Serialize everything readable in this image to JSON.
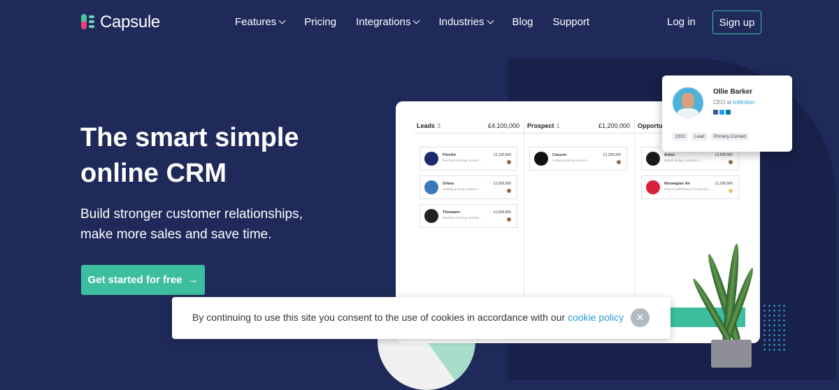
{
  "brand": {
    "name": "Capsule"
  },
  "nav": {
    "items": [
      {
        "label": "Features",
        "dropdown": true
      },
      {
        "label": "Pricing",
        "dropdown": false
      },
      {
        "label": "Integrations",
        "dropdown": true
      },
      {
        "label": "Industries",
        "dropdown": true
      },
      {
        "label": "Blog",
        "dropdown": false
      },
      {
        "label": "Support",
        "dropdown": false
      }
    ],
    "login_label": "Log in",
    "signup_label": "Sign up"
  },
  "hero": {
    "headline": "The smart simple online CRM",
    "subline": "Build stronger customer relationships, make more sales and save time.",
    "cta_label": "Get started for free",
    "cta_icon": "arrow-right-icon"
  },
  "board": {
    "columns": [
      {
        "title": "Leads",
        "count": "3",
        "amount": "£4,100,000",
        "cards": [
          {
            "name": "FinnAir",
            "desc": "Brochure printing contract...",
            "value": "£1,100,000",
            "color": "#1b2a6b"
          },
          {
            "name": "Orbea",
            "desc": "Catalog printing contract...",
            "value": "£1,500,000",
            "color": "#3b78b8"
          },
          {
            "name": "Thomann",
            "desc": "Brochure printing contract...",
            "value": "£1,500,000",
            "color": "#222222"
          }
        ]
      },
      {
        "title": "Prospect",
        "count": "1",
        "amount": "£1,200,000",
        "cards": [
          {
            "name": "Canyon",
            "desc": "Catalog printing contract...",
            "value": "£1,200,000",
            "color": "#111111"
          }
        ]
      },
      {
        "title": "Opportu",
        "count": "",
        "amount": "",
        "cards": [
          {
            "name": "Axios",
            "desc": "Report design, printing & ...",
            "value": "£1,500,000",
            "color": "#1a1a1a"
          },
          {
            "name": "Norwegian Air",
            "desc": "Report publishing & localisation...",
            "value": "£1,200,000",
            "color": "#d6203a"
          }
        ]
      }
    ]
  },
  "profile": {
    "name": "Ollie Barker",
    "role_prefix": "CEO at",
    "company": "InMotion",
    "tags": [
      "CEO",
      "Lead",
      "Primary Contact"
    ]
  },
  "cookie": {
    "text": "By continuing to use this site you consent to the use of cookies in accordance with our",
    "link_label": "cookie policy",
    "close_label": "✕"
  },
  "colors": {
    "background": "#1f2a5a",
    "accent": "#3dbf9f",
    "link": "#2a9fd8"
  }
}
